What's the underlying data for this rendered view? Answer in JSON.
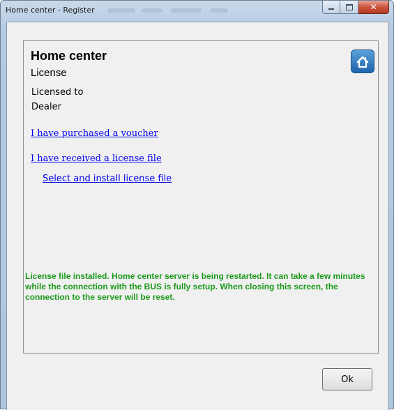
{
  "window": {
    "title": "Home center - Register",
    "controls": [
      "minimize",
      "maximize",
      "close"
    ]
  },
  "header": {
    "app_name": "Home center",
    "section_title": "License",
    "icon": "home-icon"
  },
  "license": {
    "licensed_to_label": "Licensed to",
    "licensee": "Dealer"
  },
  "links": {
    "purchased_voucher": "I have purchased a voucher",
    "received_license_file": "I have received a license file",
    "select_install": "Select and install license file"
  },
  "status": {
    "message": "License file installed. Home center server is being restarted. It can take a few minutes while the connection with the BUS is fully setup. When closing this screen, the connection to the server will be reset.",
    "color": "#1c9a1c"
  },
  "footer": {
    "ok_label": "Ok"
  },
  "colors": {
    "link": "#0000ee",
    "icon_accent": "#2e7cc4"
  }
}
